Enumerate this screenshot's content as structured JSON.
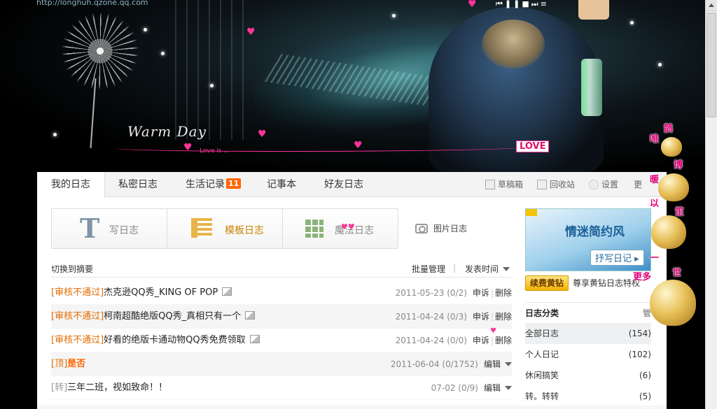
{
  "banner": {
    "url_text": "http://longhuh.qzone.qq.com",
    "deco_text": "Warm Day",
    "love_is": "Love is ...",
    "love_tag": "LOVE",
    "music_controls": "⏮❚❚■⏭≡"
  },
  "tabs": [
    {
      "label": "我的日志"
    },
    {
      "label": "私密日志"
    },
    {
      "label": "生活记录",
      "badge": "11"
    },
    {
      "label": "记事本"
    },
    {
      "label": "好友日志"
    }
  ],
  "toolbar": {
    "drafts": "草稿箱",
    "recycle": "回收站",
    "settings": "设置",
    "more": "更"
  },
  "write": {
    "write_label": "写日志",
    "template_label": "模板日志",
    "magic_label": "魔法日志",
    "photo_label": "图片日志"
  },
  "list_bar": {
    "switch_summary": "切换到摘要",
    "batch_manage": "批量管理",
    "sort_label": "发表时间"
  },
  "rows": [
    {
      "tag": "[审核不通过]",
      "title": "杰克逊QQ秀_KING OF POP",
      "date": "2011-05-23",
      "stats": "(0/2)",
      "act1": "申诉",
      "act2": "删除"
    },
    {
      "tag": "[审核不通过]",
      "title": "柯南超酷绝版QQ秀_真相只有一个",
      "date": "2011-04-24",
      "stats": "(0/3)",
      "act1": "申诉",
      "act2": "删除"
    },
    {
      "tag": "[审核不通过]",
      "title": "好看的绝版卡通动物QQ秀免费领取",
      "date": "2011-04-24",
      "stats": "(0/0)",
      "act1": "申诉",
      "act2": "删除"
    },
    {
      "tag": "[顶]",
      "title": "是否",
      "date": "2011-06-04",
      "stats": "(0/1752)",
      "act1": "编辑"
    },
    {
      "tag": "[转]",
      "title": "三年二班，视如致命！！",
      "date": "07-02",
      "stats": "(0/9)",
      "act1": "编辑"
    }
  ],
  "sidebar": {
    "ad_headline": "情迷简约风",
    "ad_button": "抒写日记 ▸",
    "vip_button": "续费黄钻",
    "vip_desc": "尊享黄钻日志特权",
    "category_title": "日志分类",
    "category_manage": "管",
    "categories": [
      {
        "name": "全部日志",
        "count": "(154)"
      },
      {
        "name": "个人日记",
        "count": "(102)"
      },
      {
        "name": "休闲搞笑",
        "count": "(6)"
      },
      {
        "name": "转。转转",
        "count": "(5)"
      }
    ]
  },
  "overlay_chars": [
    "鹊",
    "唯",
    "博",
    "暖",
    "以",
    "笙",
    "一",
    "世",
    "更多"
  ],
  "colors": {
    "accent_orange": "#e36c00",
    "badge": "#ff6600",
    "vip_gold": "#f2b300",
    "love_pink": "#ff3399"
  }
}
